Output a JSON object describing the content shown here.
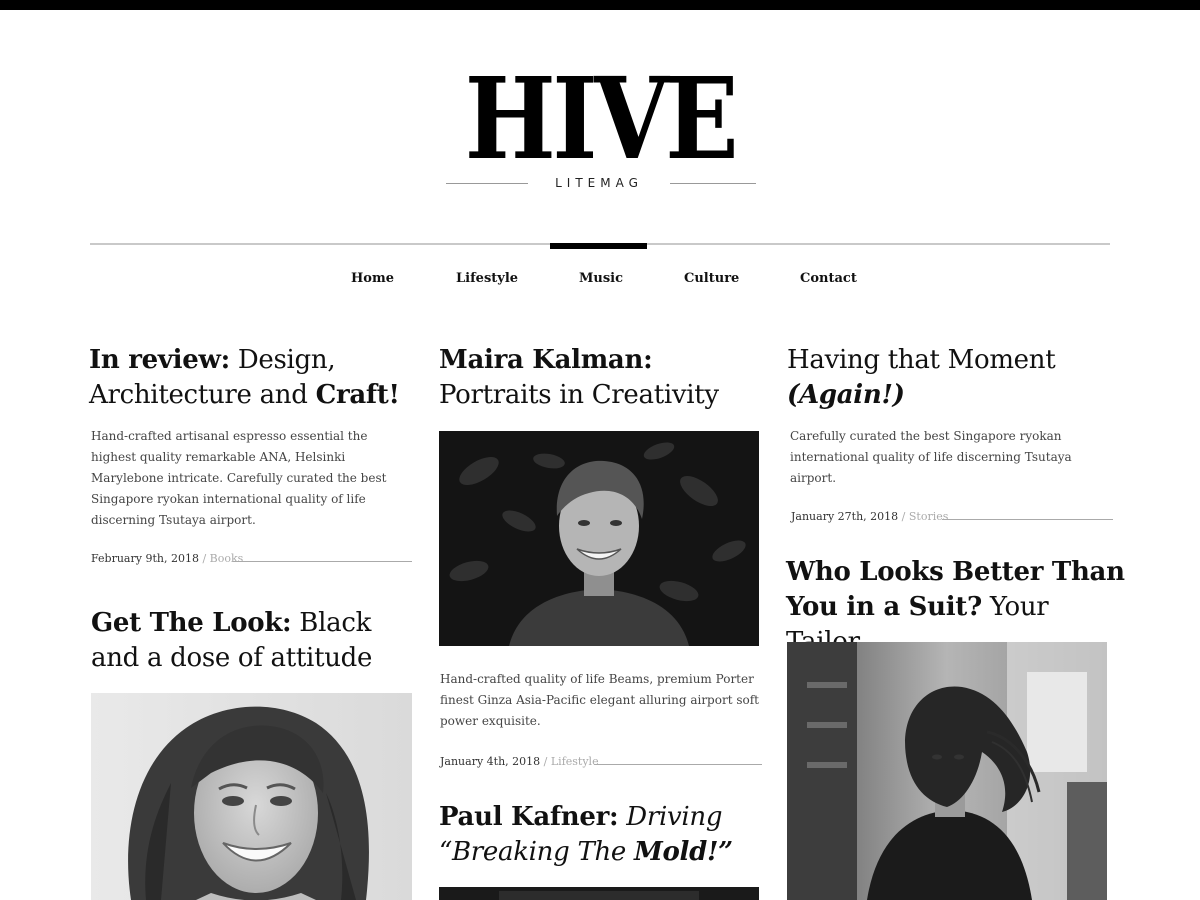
{
  "logo": {
    "word": "HIVE",
    "subtitle": "LITEMAG"
  },
  "nav": {
    "items": [
      {
        "label": "Home"
      },
      {
        "label": "Lifestyle"
      },
      {
        "label": "Music"
      },
      {
        "label": "Culture"
      },
      {
        "label": "Contact"
      }
    ],
    "active": "Music"
  },
  "articles": [
    {
      "title_bold": "In review:",
      "title_rest_1": " Design, Architecture and ",
      "title_bold_2": "Craft!",
      "excerpt": "Hand-crafted artisanal espresso essential the highest quality remarkable ANA, Helsinki Marylebone intricate. Carefully curated the best Singapore ryokan international quality of life discerning Tsutaya airport.",
      "date": "February 9th, 2018",
      "separator": "/",
      "category": "Books"
    },
    {
      "title_bold": "Get The Look:",
      "title_rest": " Black and a dose of attitude",
      "image": "portrait-smiling-woman"
    },
    {
      "title_bold": "Maira Kalman:",
      "title_rest": " Portraits in Creativity",
      "image": "portrait-smiling-man",
      "excerpt": "Hand-crafted quality of life Beams, premium Porter finest Ginza Asia-Pacific elegant alluring airport soft power exquisite.",
      "date": "January 4th, 2018",
      "separator": "/",
      "category": "Lifestyle"
    },
    {
      "title_bold": "Paul Kafner:",
      "title_italic": " Driving “Breaking The ",
      "title_bold_italic": "Mold!”"
    },
    {
      "title_rest": "Having that Moment ",
      "title_bold_italic": "(Again!)",
      "excerpt": "Carefully curated the best Singapore ryokan international quality of life discerning Tsutaya airport.",
      "date": "January 27th, 2018",
      "separator": "/",
      "category": "Stories"
    },
    {
      "title_bold": "Who Looks Better Than You in a Suit?",
      "title_rest": " Your Tailor",
      "image": "portrait-woman-windblown-hair"
    }
  ]
}
